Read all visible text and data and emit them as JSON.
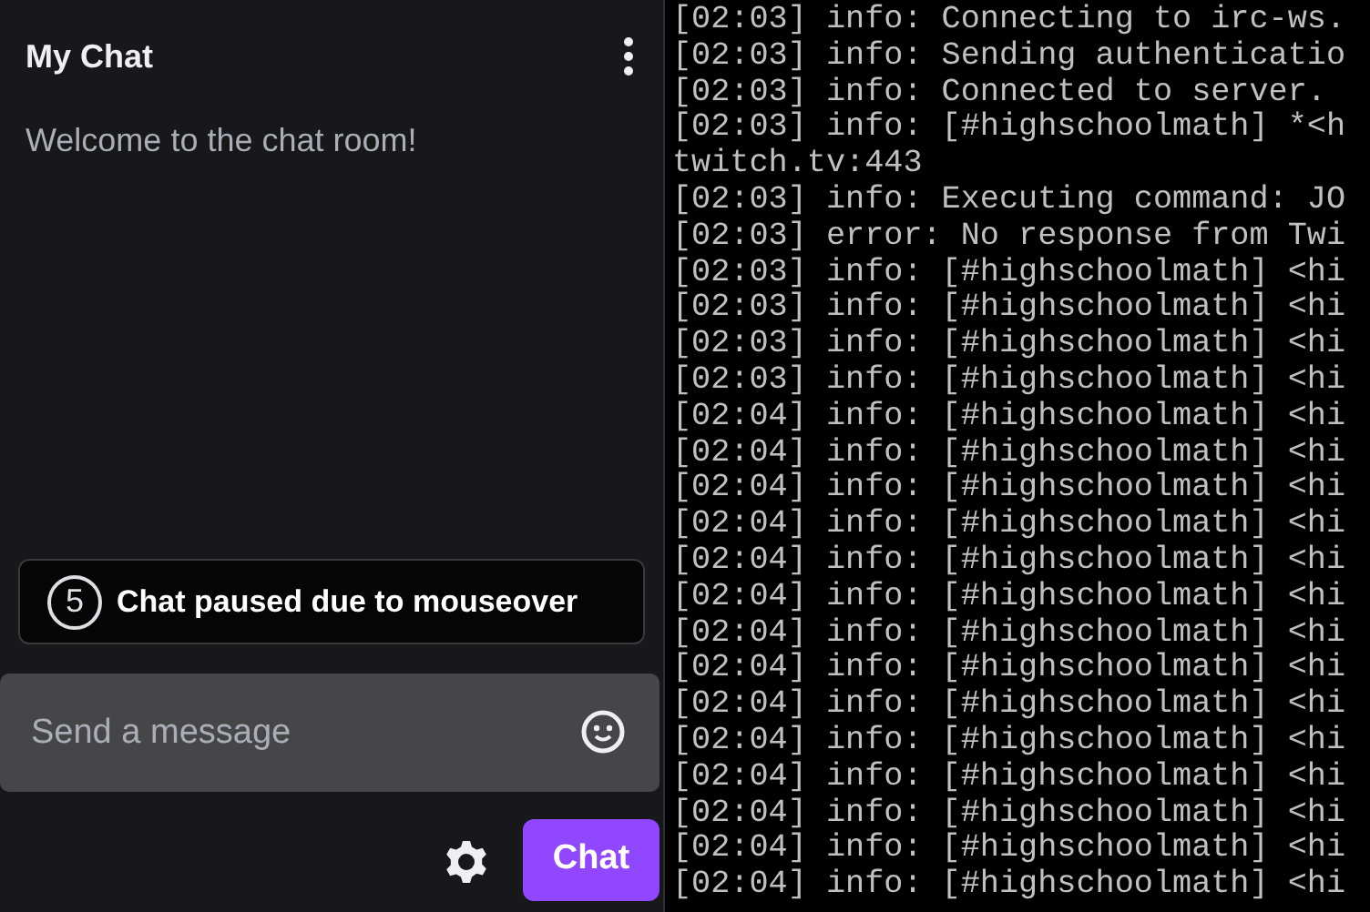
{
  "chat": {
    "title": "My Chat",
    "welcome": "Welcome to the chat room!",
    "paused_notice": {
      "countdown": "5",
      "text": "Chat paused due to mouseover"
    },
    "input": {
      "placeholder": "Send a message"
    },
    "send_button": "Chat"
  },
  "terminal": {
    "lines": [
      "[02:03] info: Connecting to irc-ws.",
      "[02:03] info: Sending authenticatio",
      "[02:03] info: Connected to server.",
      "[02:03] info: [#highschoolmath] *<h",
      "twitch.tv:443",
      "[02:03] info: Executing command: JO",
      "[02:03] error: No response from Twi",
      "[02:03] info: [#highschoolmath] <hi",
      "[02:03] info: [#highschoolmath] <hi",
      "[02:03] info: [#highschoolmath] <hi",
      "[02:03] info: [#highschoolmath] <hi",
      "[02:04] info: [#highschoolmath] <hi",
      "[02:04] info: [#highschoolmath] <hi",
      "[02:04] info: [#highschoolmath] <hi",
      "[02:04] info: [#highschoolmath] <hi",
      "[02:04] info: [#highschoolmath] <hi",
      "[02:04] info: [#highschoolmath] <hi",
      "[02:04] info: [#highschoolmath] <hi",
      "[02:04] info: [#highschoolmath] <hi",
      "[02:04] info: [#highschoolmath] <hi",
      "[02:04] info: [#highschoolmath] <hi",
      "[02:04] info: [#highschoolmath] <hi",
      "[02:04] info: [#highschoolmath] <hi",
      "[02:04] info: [#highschoolmath] <hi",
      "[02:04] info: [#highschoolmath] <hi"
    ]
  }
}
